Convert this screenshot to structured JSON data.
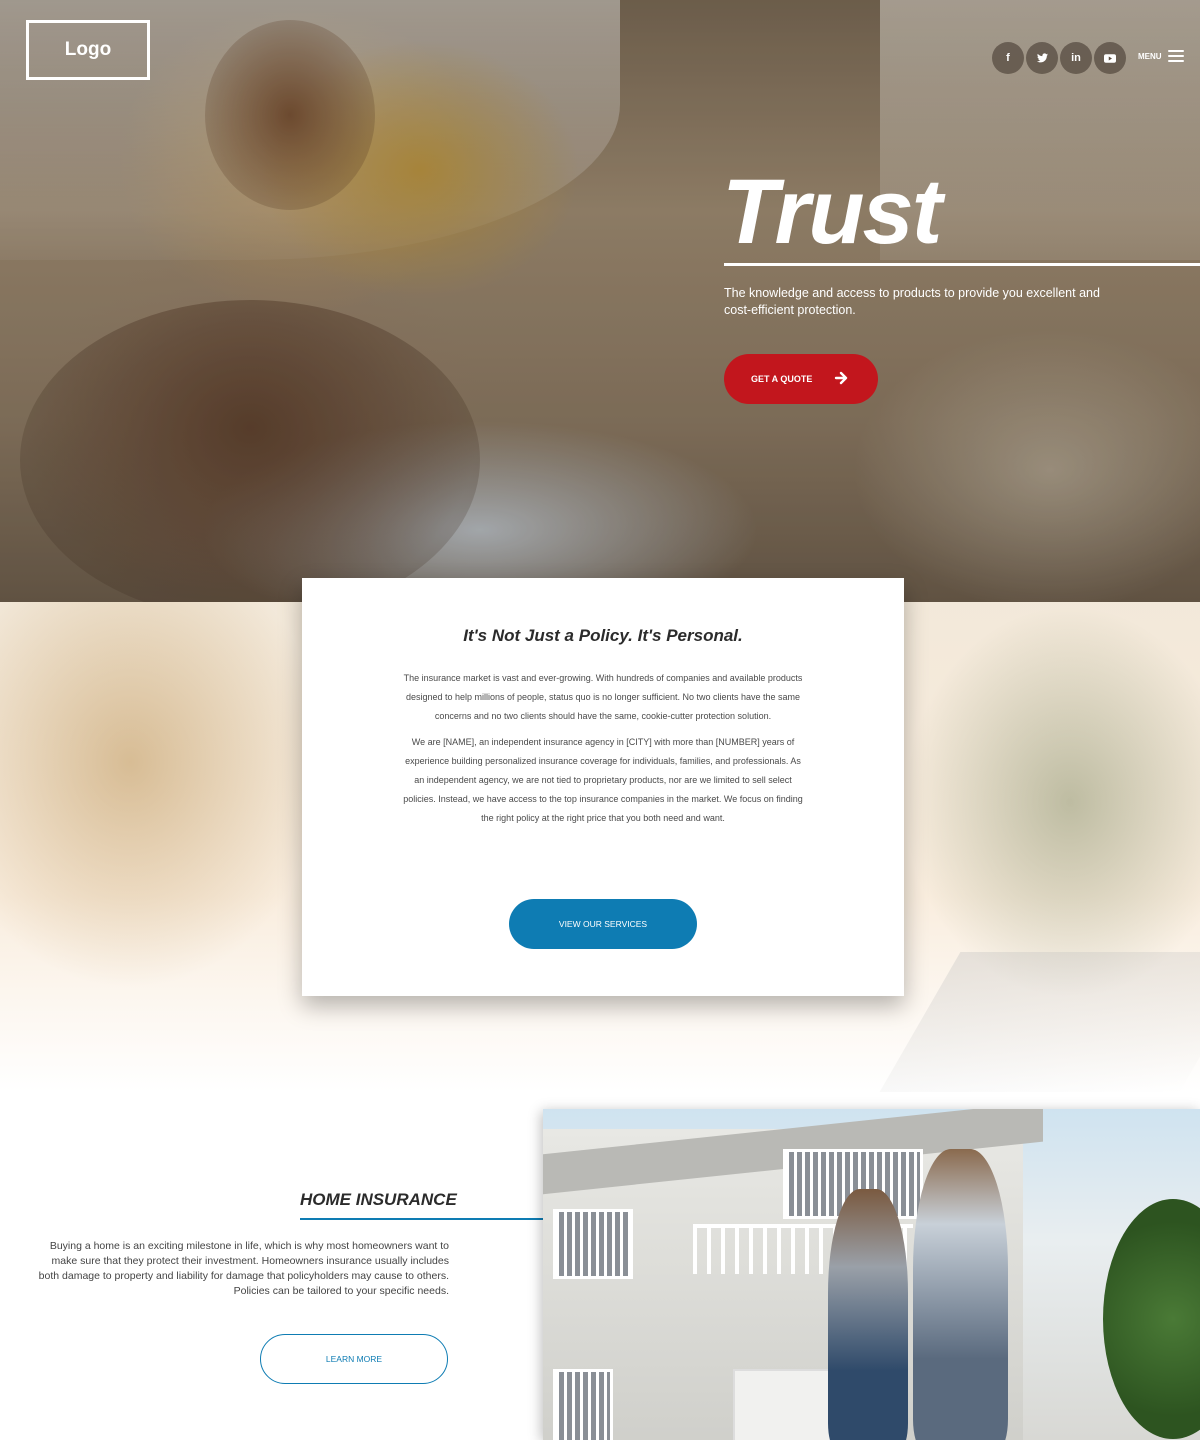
{
  "header": {
    "logo_text": "Logo",
    "social_icons": [
      "facebook-icon",
      "twitter-icon",
      "linkedin-icon",
      "youtube-icon"
    ],
    "social_glyphs": [
      "f",
      "t",
      "in",
      "▶"
    ],
    "menu_label": "MENU"
  },
  "hero": {
    "title": "Trust",
    "subtitle": "The knowledge and access to products to provide you excellent and cost-efficient protection.",
    "cta_label": "GET A QUOTE",
    "cta_color": "#c2161d"
  },
  "policy": {
    "title": "It's Not Just a Policy. It's Personal.",
    "paragraph_1": "The insurance market is vast and ever-growing. With hundreds of companies and available products designed to help millions of people, status quo is no longer sufficient. No two clients have the same concerns and no two clients should have the same, cookie-cutter protection solution.",
    "paragraph_2": "We are [NAME], an independent insurance agency in [CITY] with more than [NUMBER] years of experience building personalized insurance coverage for individuals, families, and professionals. As an independent agency, we are not tied to proprietary products, nor are we limited to sell select policies. Instead, we have access to the top insurance companies in the market. We focus on finding the right policy at the right price that you both need and want.",
    "cta_label": "VIEW OUR SERVICES",
    "cta_color": "#0e7cb3"
  },
  "home_insurance": {
    "title": "HOME INSURANCE",
    "body": "Buying a home is an exciting milestone in life, which is why most homeowners want to make sure that they protect their investment. Homeowners insurance usually includes both damage to property and liability for damage that policyholders may cause to others. Policies can be tailored to your specific needs.",
    "cta_label": "LEARN MORE"
  }
}
